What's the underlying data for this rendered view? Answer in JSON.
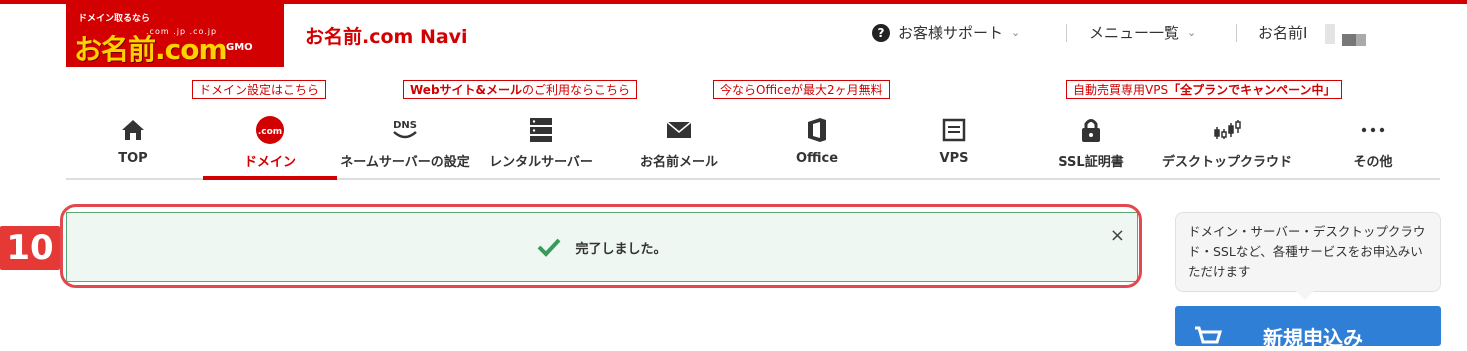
{
  "header": {
    "logo": {
      "tagline": "ドメイン取るなら",
      "domains": ".com  .jp  .co.jp",
      "brand": "お名前.com",
      "gmo": "GMO"
    },
    "navi_title": "お名前.com Navi",
    "support_label": "お客様サポート",
    "menu_label": "メニュー一覧",
    "account_label": "お名前I"
  },
  "promos": [
    {
      "text": "ドメイン設定はこちら"
    },
    {
      "bold": "Webサイト&メール",
      "text": "のご利用ならこちら"
    },
    {
      "text": "今ならOfficeが最大2ヶ月無料"
    },
    {
      "text": "自動売買専用VPS",
      "bold": "「全プランでキャンペーン中」"
    }
  ],
  "nav": [
    {
      "label": "TOP",
      "icon": "home-icon"
    },
    {
      "label": "ドメイン",
      "icon": "com-icon",
      "icon_text": ".com",
      "active": true
    },
    {
      "label": "ネームサーバーの設定",
      "icon": "dns-icon",
      "icon_text": "DNS"
    },
    {
      "label": "レンタルサーバー",
      "icon": "server-icon"
    },
    {
      "label": "お名前メール",
      "icon": "mail-icon"
    },
    {
      "label": "Office",
      "icon": "office-icon"
    },
    {
      "label": "VPS",
      "icon": "vps-icon"
    },
    {
      "label": "SSL証明書",
      "icon": "lock-icon"
    },
    {
      "label": "デスクトップクラウド",
      "icon": "chart-icon"
    },
    {
      "label": "その他",
      "icon": "more-icon"
    }
  ],
  "alert": {
    "message": "完了しました。",
    "close": "×"
  },
  "step_badge": "10",
  "sidebar": {
    "tooltip": "ドメイン・サーバー・デスクトップクラウド・SSLなど、各種サービスをお申込みいただけます",
    "apply_button": "新規申込み"
  },
  "colors": {
    "brand_red": "#d20000",
    "success_green": "#3a9a5a",
    "highlight_red": "#e3484e",
    "button_blue": "#2f7fd6"
  }
}
